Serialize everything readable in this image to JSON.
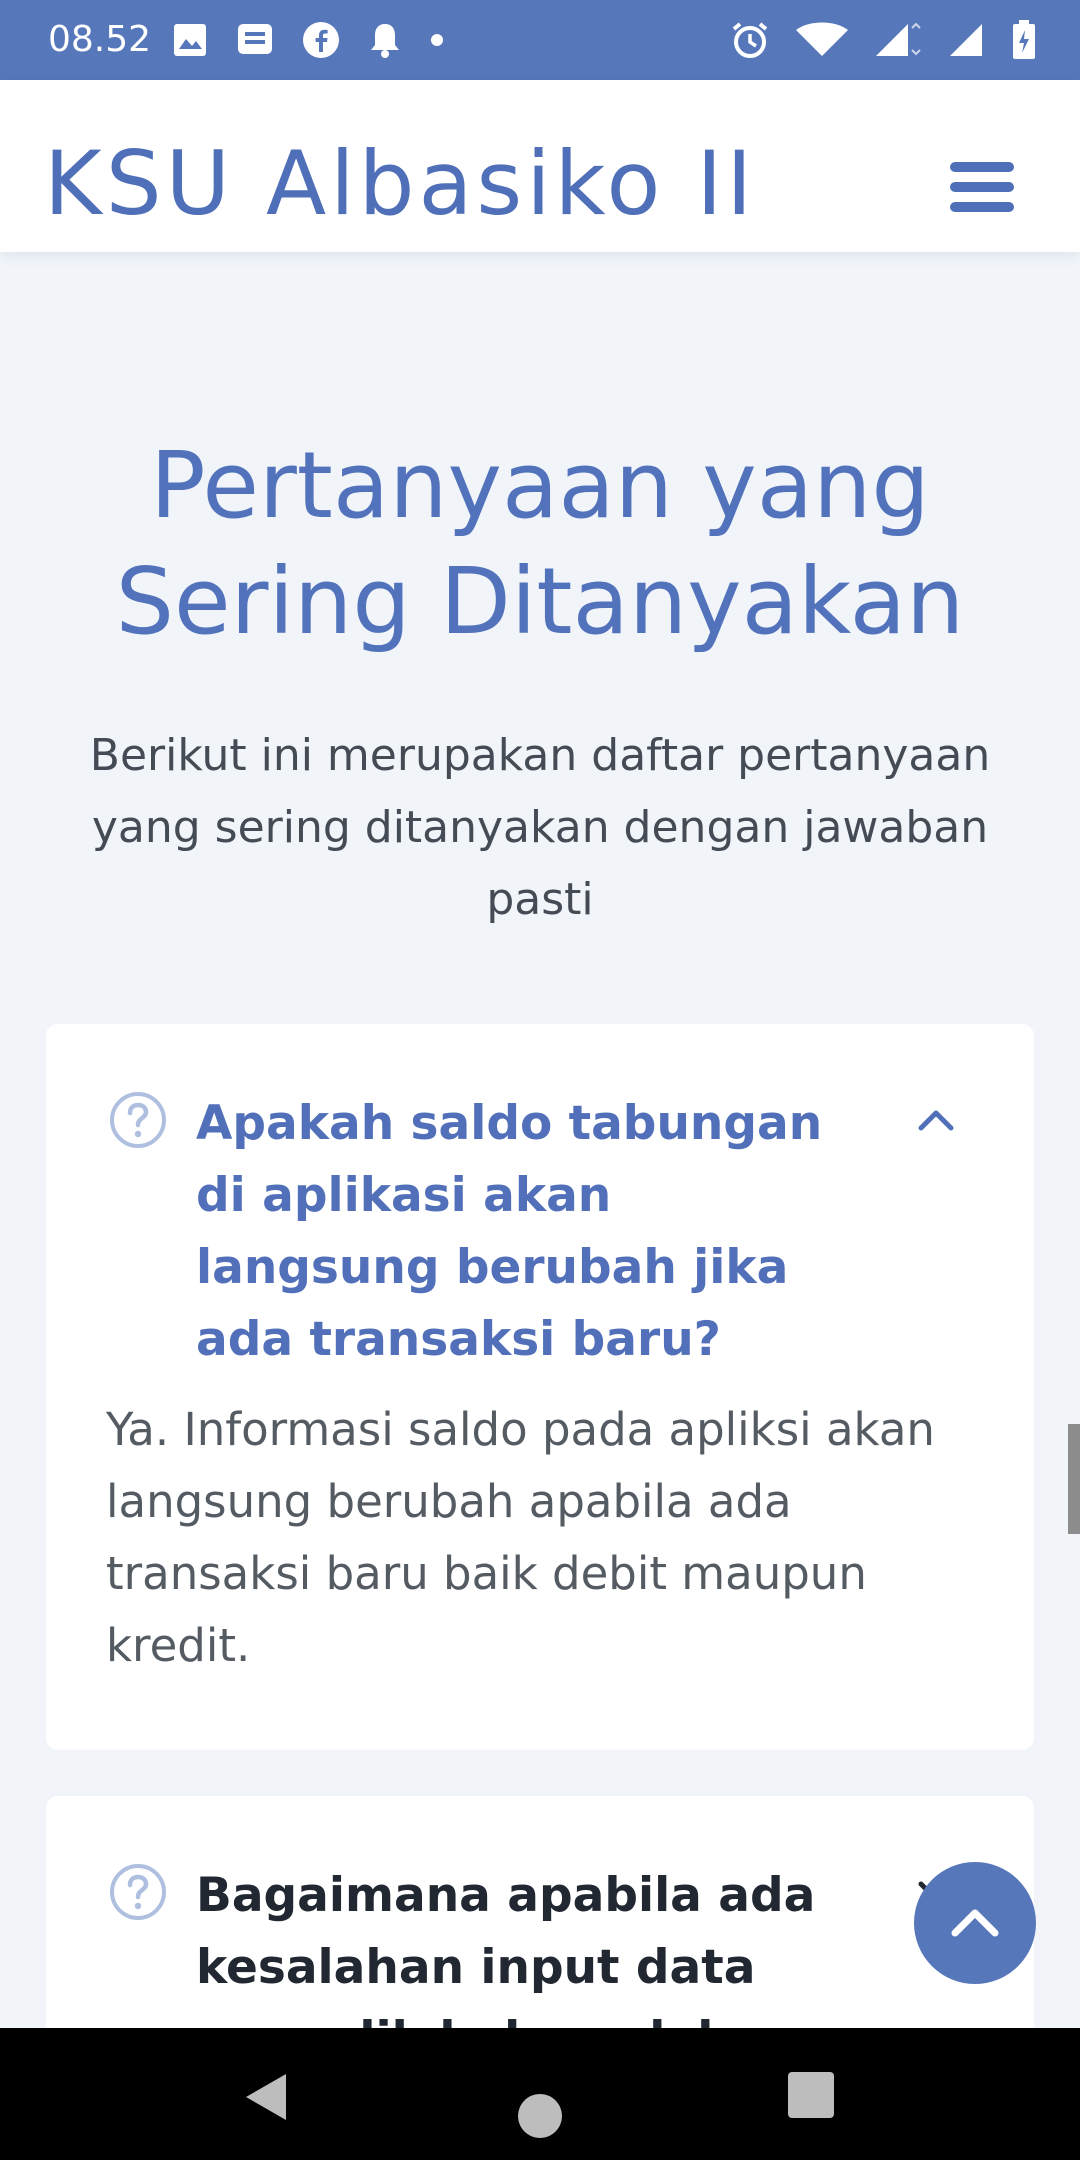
{
  "status_bar": {
    "time": "08.52",
    "left_icons": [
      "image-icon",
      "message-icon",
      "facebook-icon",
      "bell-icon",
      "dot-icon"
    ],
    "right_icons": [
      "alarm-icon",
      "wifi-icon",
      "signal-icon",
      "signal-icon",
      "battery-charging-icon"
    ]
  },
  "header": {
    "brand": "KSU Albasiko II",
    "menu_icon": "hamburger-menu-icon"
  },
  "faq_section": {
    "title": "Pertanyaan yang Sering Ditanyakan",
    "subtitle": "Berikut ini merupakan daftar pertanyaan yang sering ditanyakan dengan jawaban pasti",
    "items": [
      {
        "question": "Apakah saldo tabungan di aplikasi akan langsung berubah jika ada transaksi baru?",
        "answer": "Ya. Informasi saldo pada apliksi akan langsung berubah apabila ada transaksi baru baik debit maupun kredit.",
        "expanded": true
      },
      {
        "question": "Bagaimana apabila ada kesalahan input data yang dilakukan oleh",
        "expanded": false
      }
    ]
  },
  "back_to_top_icon": "chevron-up-icon",
  "colors": {
    "accent": "#5777bb",
    "title": "#5272bc",
    "background": "#f1f5fa"
  }
}
